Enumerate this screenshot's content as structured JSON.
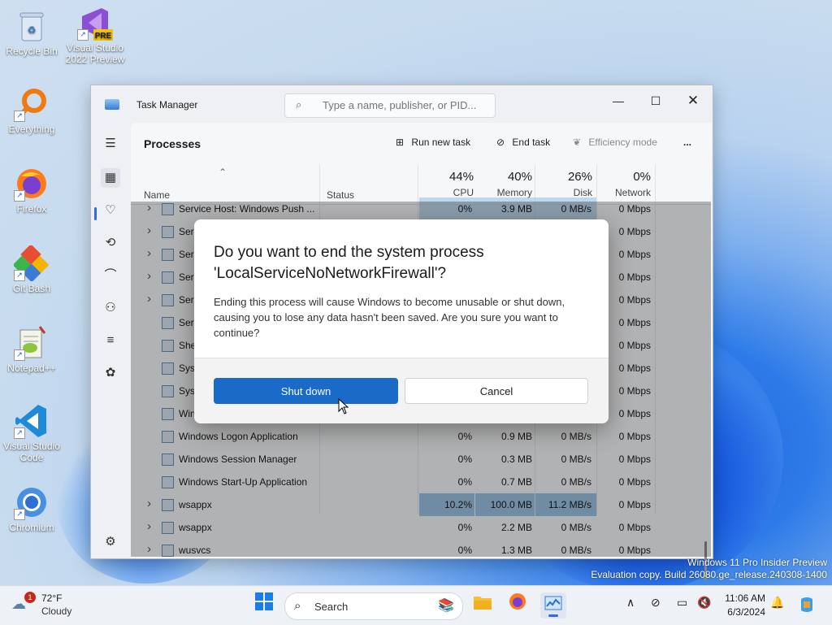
{
  "desktop": {
    "icons": [
      {
        "label": "Recycle Bin"
      },
      {
        "label": "Visual Studio 2022 Preview",
        "badge": "PRE"
      },
      {
        "label": "Everything"
      },
      {
        "label": "Firefox"
      },
      {
        "label": "Git Bash"
      },
      {
        "label": "Notepad++"
      },
      {
        "label": "Visual Studio Code"
      },
      {
        "label": "Chromium"
      }
    ],
    "watermark_line1": "Windows 11 Pro Insider Preview",
    "watermark_line2": "Evaluation copy. Build 26080.ge_release.240308-1400"
  },
  "task_manager": {
    "title": "Task Manager",
    "search_placeholder": "Type a name, publisher, or PID...",
    "page_title": "Processes",
    "toolbar": {
      "run_new_task": "Run new task",
      "end_task": "End task",
      "efficiency_mode": "Efficiency mode",
      "more": "..."
    },
    "columns": {
      "name": "Name",
      "status": "Status",
      "cpu_pct": "44%",
      "cpu_label": "CPU",
      "mem_pct": "40%",
      "mem_label": "Memory",
      "disk_pct": "26%",
      "disk_label": "Disk",
      "net_pct": "0%",
      "net_label": "Network"
    },
    "rows": [
      {
        "name": "Service Host: Windows Push ...",
        "cpu": "0%",
        "mem": "3.9 MB",
        "disk": "0 MB/s",
        "net": "0 Mbps",
        "expand": true
      },
      {
        "name": "Serv",
        "net": "0 Mbps",
        "expand": true
      },
      {
        "name": "Serv",
        "net": "0 Mbps",
        "expand": true
      },
      {
        "name": "Serv",
        "net": "0 Mbps",
        "expand": true
      },
      {
        "name": "Serv",
        "net": "0 Mbps",
        "expand": true
      },
      {
        "name": "Serv",
        "net": "0 Mbps",
        "expand": false
      },
      {
        "name": "She",
        "net": "0 Mbps",
        "expand": false
      },
      {
        "name": "Syst",
        "net": "0 Mbps",
        "expand": false
      },
      {
        "name": "Syst",
        "net": "0 Mbps",
        "expand": false
      },
      {
        "name": "Win",
        "net": "0 Mbps",
        "expand": false
      },
      {
        "name": "Windows Logon Application",
        "cpu": "0%",
        "mem": "0.9 MB",
        "disk": "0 MB/s",
        "net": "0 Mbps",
        "expand": false
      },
      {
        "name": "Windows Session Manager",
        "cpu": "0%",
        "mem": "0.3 MB",
        "disk": "0 MB/s",
        "net": "0 Mbps",
        "expand": false
      },
      {
        "name": "Windows Start-Up Application",
        "cpu": "0%",
        "mem": "0.7 MB",
        "disk": "0 MB/s",
        "net": "0 Mbps",
        "expand": false
      },
      {
        "name": "wsappx",
        "cpu": "10.2%",
        "mem": "100.0 MB",
        "disk": "11.2 MB/s",
        "net": "0 Mbps",
        "expand": true
      },
      {
        "name": "wsappx",
        "cpu": "0%",
        "mem": "2.2 MB",
        "disk": "0 MB/s",
        "net": "0 Mbps",
        "expand": true
      },
      {
        "name": "wusvcs",
        "cpu": "0%",
        "mem": "1.3 MB",
        "disk": "0 MB/s",
        "net": "0 Mbps",
        "expand": true
      }
    ]
  },
  "dialog": {
    "title": "Do you want to end the system process 'LocalServiceNoNetworkFirewall'?",
    "body": "Ending this process will cause Windows to become unusable or shut down, causing you to lose any data hasn't been saved. Are you sure you want to continue?",
    "primary": "Shut down",
    "secondary": "Cancel"
  },
  "taskbar": {
    "weather_temp": "72°F",
    "weather_cond": "Cloudy",
    "weather_badge": "1",
    "search_label": "Search",
    "time": "11:06 AM",
    "date": "6/3/2024"
  }
}
